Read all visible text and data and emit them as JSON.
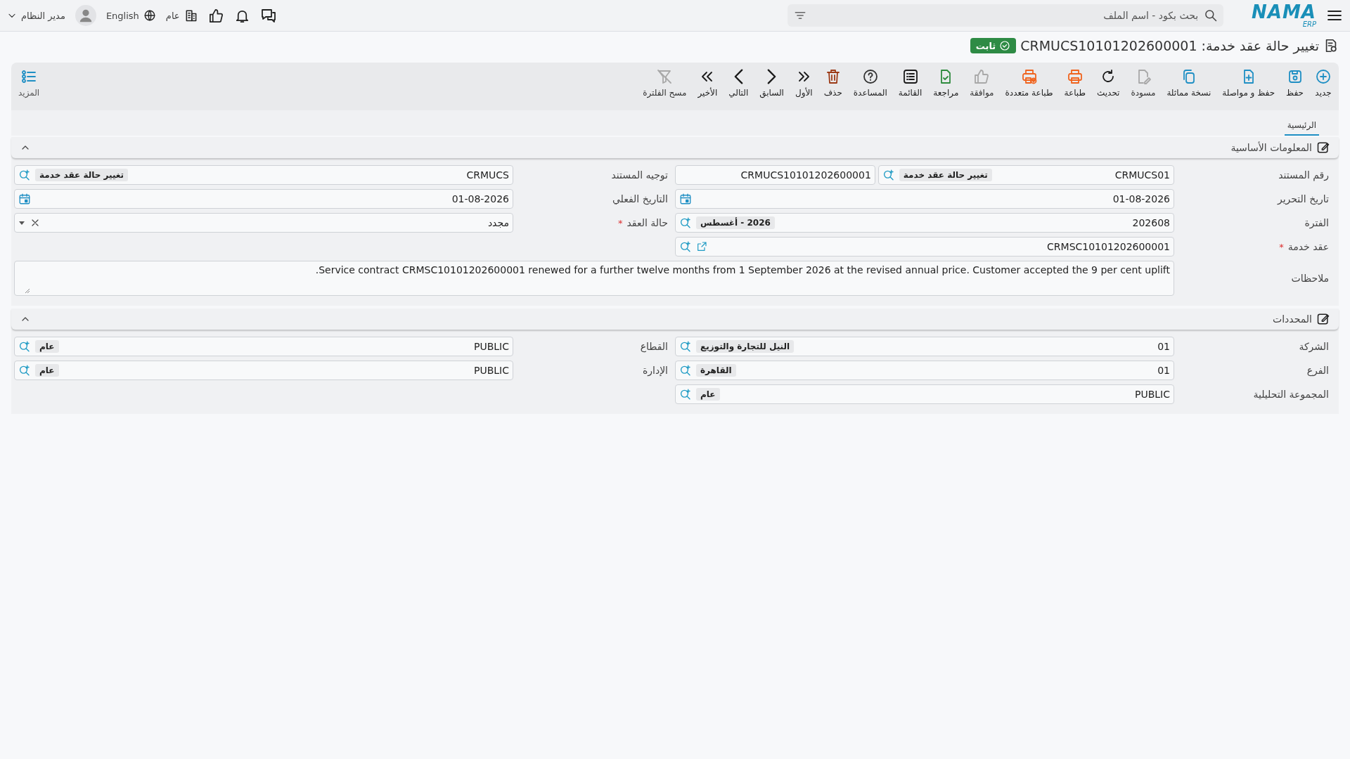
{
  "header": {
    "logo": "NAMA",
    "logo_sub": "ERP",
    "search_placeholder": "بحث بكود - اسم الملف",
    "company": "عام",
    "language": "English",
    "user_name": "مدير النظام"
  },
  "title": {
    "text": "تغيير حالة عقد خدمة: CRMUCS10101202600001",
    "status": "ثابت"
  },
  "toolbar": [
    {
      "label": "جديد",
      "kind": "new",
      "disabled": false
    },
    {
      "label": "حفظ",
      "kind": "save",
      "disabled": false
    },
    {
      "label": "حفظ و مواصلة",
      "kind": "save_continue",
      "disabled": false
    },
    {
      "label": "نسخة مماثلة",
      "kind": "duplicate",
      "disabled": false
    },
    {
      "label": "مسودة",
      "kind": "draft",
      "disabled": true
    },
    {
      "label": "تحديث",
      "kind": "refresh",
      "disabled": false
    },
    {
      "label": "طباعة",
      "kind": "print",
      "disabled": false
    },
    {
      "label": "طباعة متعددة",
      "kind": "multi_print",
      "disabled": false
    },
    {
      "label": "موافقة",
      "kind": "approve",
      "disabled": true
    },
    {
      "label": "مراجعة",
      "kind": "review",
      "disabled": false
    },
    {
      "label": "القائمة",
      "kind": "list",
      "disabled": false
    },
    {
      "label": "المساعدة",
      "kind": "help",
      "disabled": false
    },
    {
      "label": "حذف",
      "kind": "delete",
      "disabled": false
    },
    {
      "label": "الأول",
      "kind": "first",
      "disabled": false
    },
    {
      "label": "السابق",
      "kind": "previous",
      "disabled": false
    },
    {
      "label": "التالي",
      "kind": "next",
      "disabled": false
    },
    {
      "label": "الأخير",
      "kind": "last",
      "disabled": false
    },
    {
      "label": "مسح الفلترة",
      "kind": "clear_filter",
      "disabled": true
    }
  ],
  "more": {
    "label": "المزيد"
  },
  "tabs": [
    {
      "label": "الرئيسية",
      "selected": true
    }
  ],
  "sections": [
    {
      "title": "المعلومات الأساسية",
      "expanded": true,
      "columns": [
        [
          {
            "kind": "lookup_number",
            "label": "رقم المستند",
            "value": "CRMUCS01",
            "tag": "تغيير حالة عقد خدمة",
            "number": "CRMUCS10101202600001"
          },
          {
            "kind": "date",
            "label": "تاريخ التحرير",
            "value": "01-08-2026"
          },
          {
            "kind": "lookup",
            "label": "الفترة",
            "value": "202608",
            "tag": "2026 - أغسطس"
          },
          {
            "kind": "lookup_link",
            "label": "عقد خدمة",
            "required_mark": "*",
            "value": "CRMSC10101202600001"
          }
        ],
        [
          {
            "kind": "lookup",
            "label": "توجيه المستند",
            "value": "CRMUCS",
            "tag": "تغيير حالة عقد خدمة"
          },
          {
            "kind": "date",
            "label": "التاريخ الفعلي",
            "value": "01-08-2026"
          },
          {
            "kind": "select",
            "label": "حالة العقد",
            "required_mark": "*",
            "value": "مجدد"
          }
        ]
      ],
      "notes": {
        "label": "ملاحظات",
        "value": "Service contract CRMSC10101202600001 renewed for a further twelve months from 1 September 2026 at the revised annual price. Customer accepted the 9 per cent uplift."
      }
    },
    {
      "title": "المحددات",
      "expanded": true,
      "columns": [
        [
          {
            "kind": "lookup",
            "label": "الشركة",
            "value": "01",
            "tag": "النيل للتجارة والتوزيع"
          },
          {
            "kind": "lookup",
            "label": "الفرع",
            "value": "01",
            "tag": "القاهرة"
          },
          {
            "kind": "lookup",
            "label": "المجموعة التحليلية",
            "value": "PUBLIC",
            "tag": "عام"
          }
        ],
        [
          {
            "kind": "lookup",
            "label": "القطاع",
            "value": "PUBLIC",
            "tag": "عام"
          },
          {
            "kind": "lookup",
            "label": "الإدارة",
            "value": "PUBLIC",
            "tag": "عام"
          }
        ]
      ]
    }
  ]
}
